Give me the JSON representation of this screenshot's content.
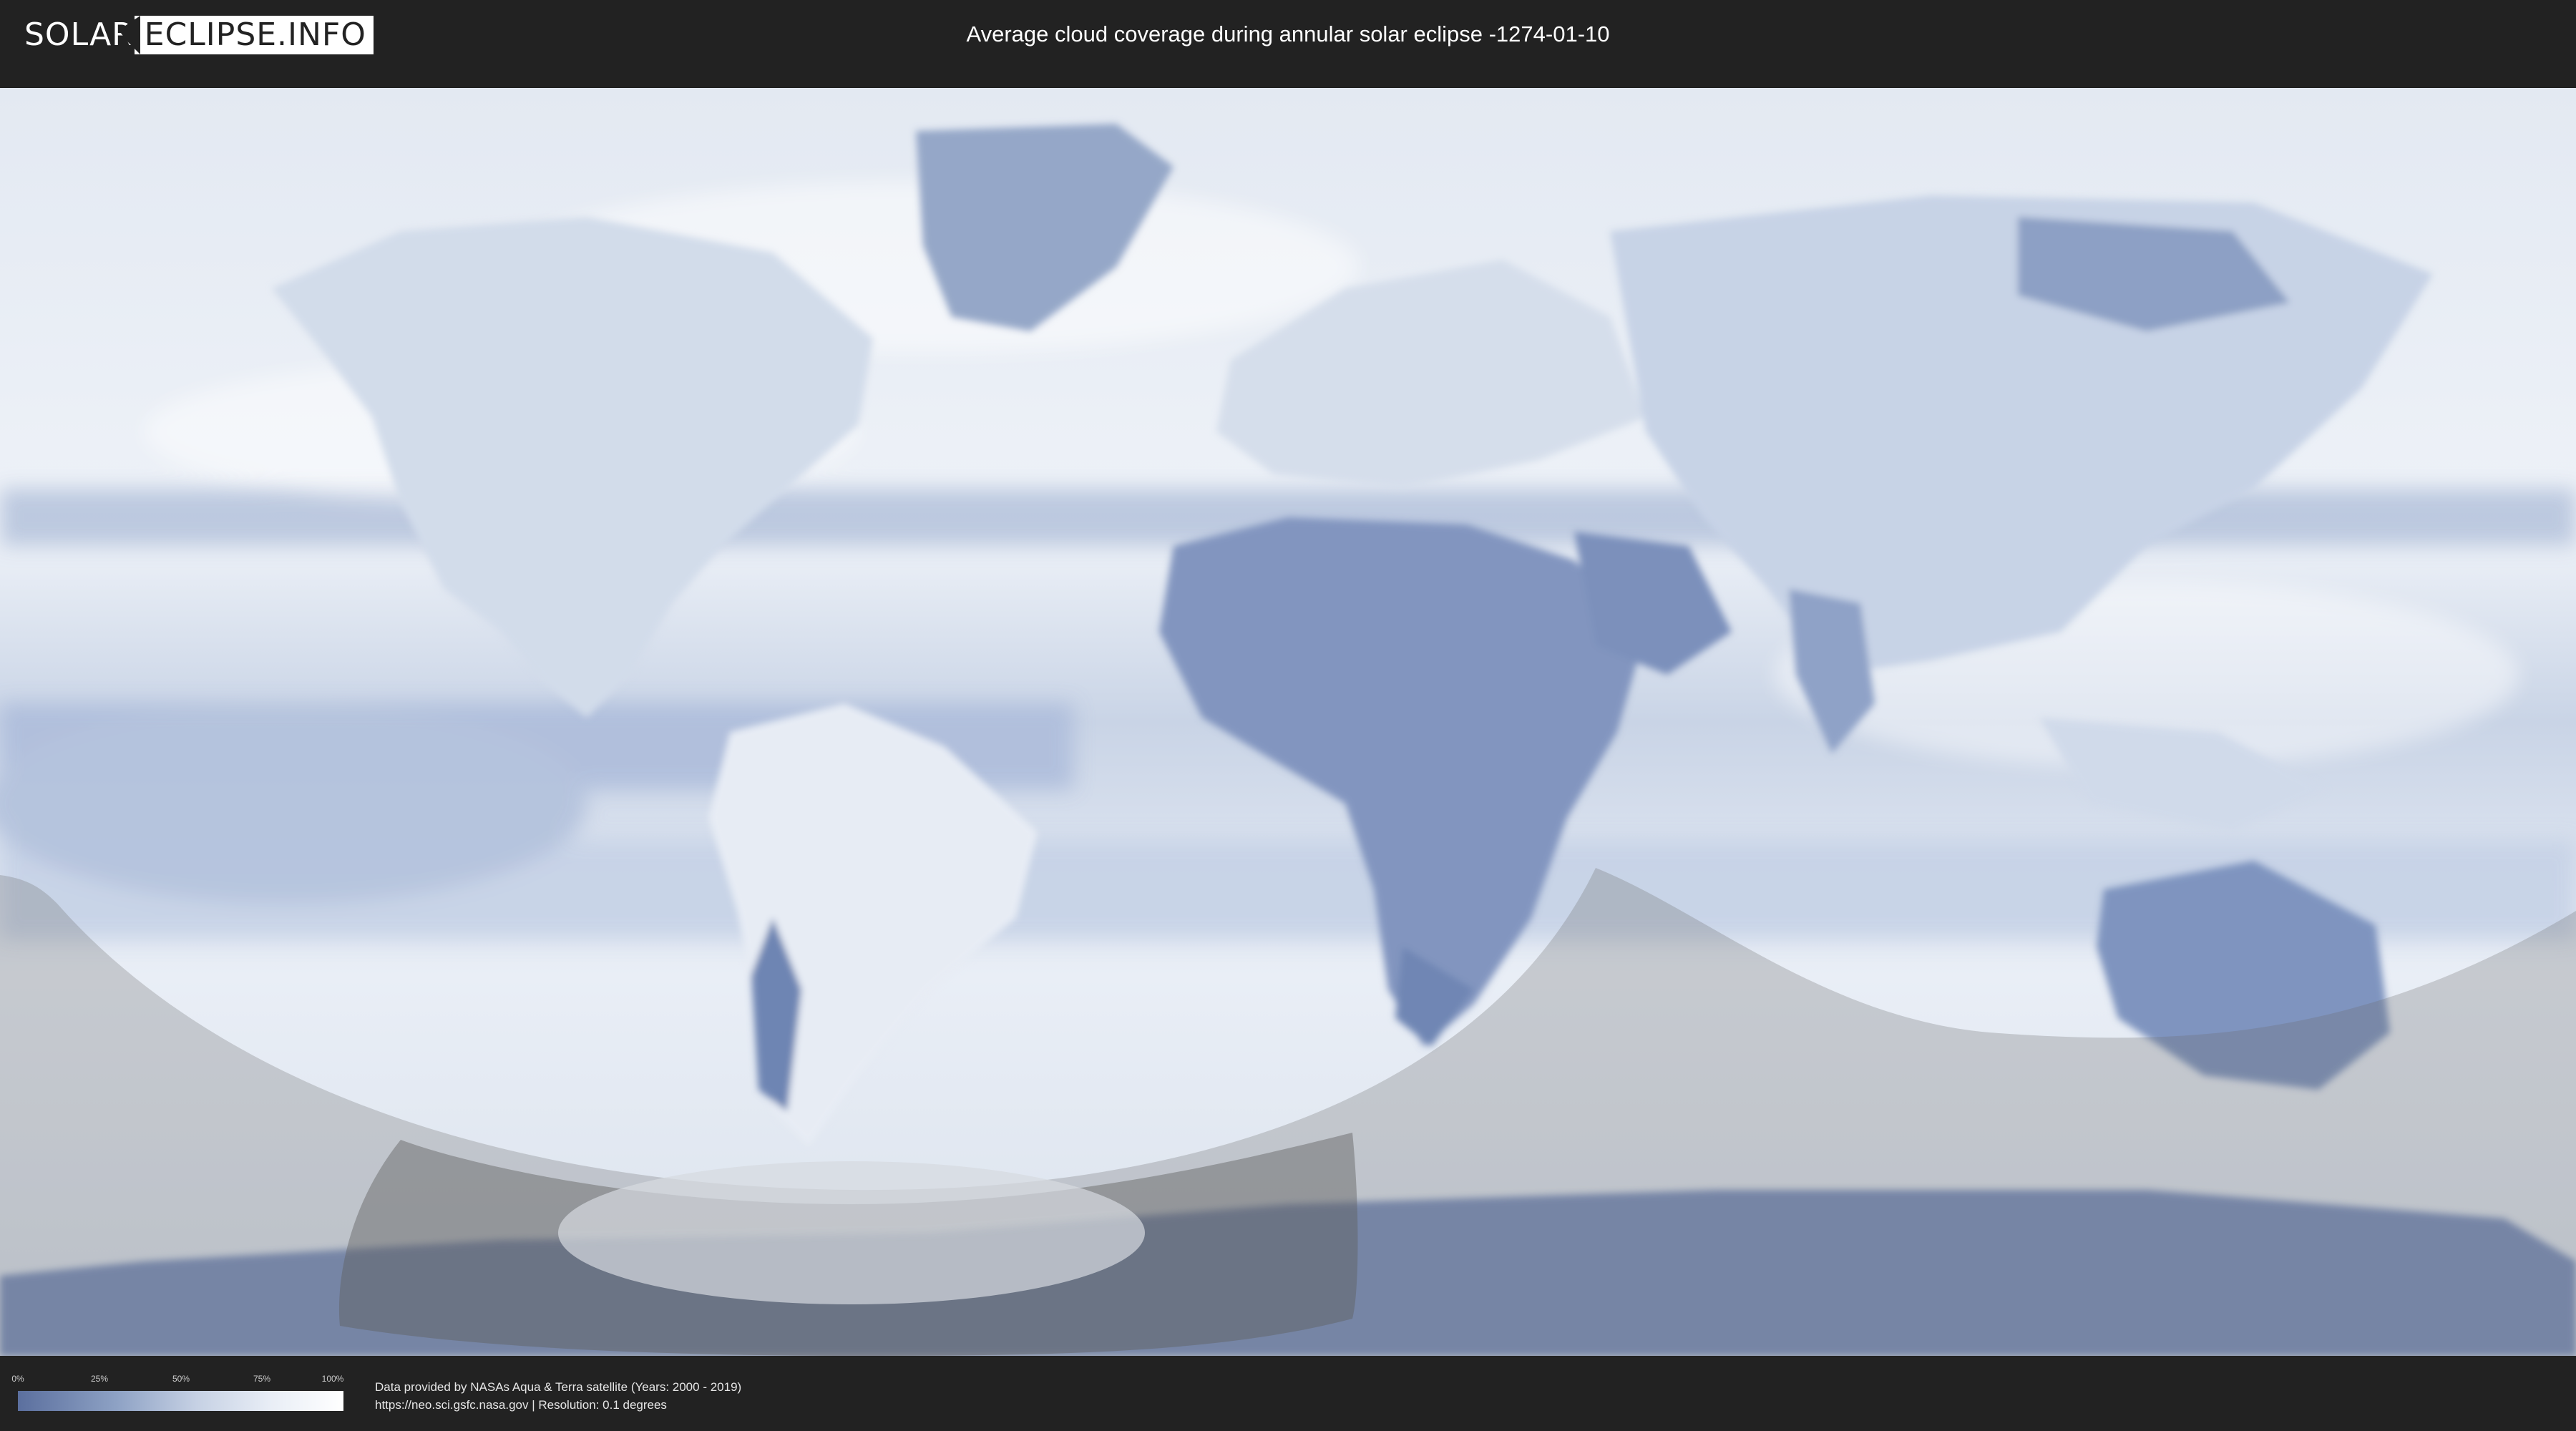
{
  "header": {
    "logo_left": "SOLAR",
    "logo_right": "ECLIPSE.INFO",
    "title": "Average cloud coverage during annular solar eclipse -1274-01-10"
  },
  "legend": {
    "ticks": [
      "0%",
      "25%",
      "50%",
      "75%",
      "100%"
    ],
    "colors": [
      "#5b6f9e",
      "#8da1c4",
      "#c6d1e4",
      "#e9eef6",
      "#ffffff"
    ]
  },
  "credit": {
    "line1": "Data provided by NASAs Aqua & Terra satellite (Years: 2000 - 2019)",
    "line2": "https://neo.sci.gsfc.nasa.gov | Resolution: 0.1 degrees"
  },
  "map": {
    "projection": "equirectangular",
    "palette": {
      "ocean_cloudy": "#dfe7f1",
      "land_clear": "#7f93bb",
      "clear_sky": "#9fb0cf",
      "shadow_overlay": "#6b6b6b",
      "annular_core": "#cfd3d8"
    }
  }
}
